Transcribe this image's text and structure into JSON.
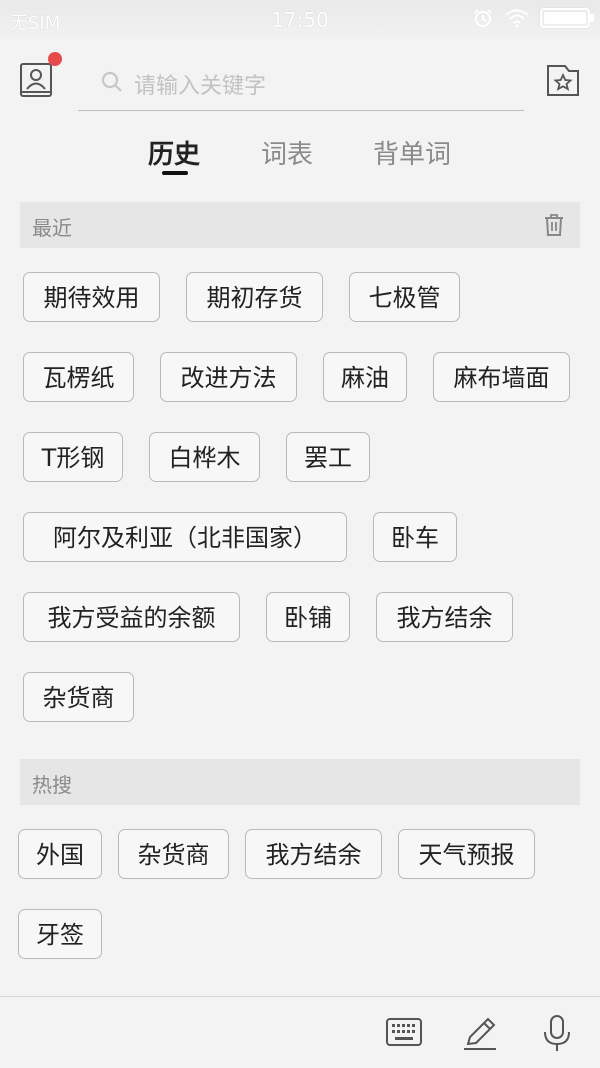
{
  "status_bar": {
    "carrier": "无SIM",
    "time": "17:50",
    "icons": [
      "alarm-icon",
      "wifi-icon",
      "battery-icon"
    ]
  },
  "header": {
    "profile_icon": "profile-book-icon",
    "notification_dot_color": "#e74a4a",
    "search_placeholder": "请输入关键字",
    "favorites_icon": "star-folder-icon"
  },
  "tabs": [
    {
      "label": "历史",
      "active": true
    },
    {
      "label": "词表",
      "active": false
    },
    {
      "label": "背单词",
      "active": false
    }
  ],
  "recent": {
    "title": "最近",
    "clear_icon": "trash-icon",
    "items": [
      "期待效用",
      "期初存货",
      "七极管",
      "瓦楞纸",
      "改进方法",
      "麻油",
      "麻布墙面",
      "T形钢",
      "白桦木",
      "罢工",
      "阿尔及利亚（北非国家）",
      "卧车",
      "我方受益的余额",
      "卧铺",
      "我方结余",
      "杂货商"
    ]
  },
  "hot": {
    "title": "热搜",
    "items": [
      "外国",
      "杂货商",
      "我方结余",
      "天气预报",
      "牙签"
    ]
  },
  "toolbar": {
    "icons": [
      "keyboard-icon",
      "pen-icon",
      "microphone-icon"
    ]
  }
}
